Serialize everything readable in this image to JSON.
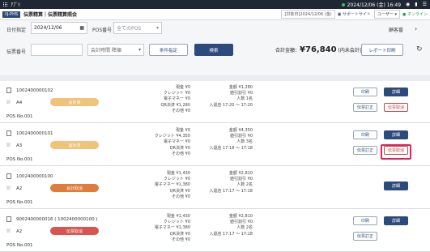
{
  "topbar": {
    "app_name": "ｱﾌﾟﾘ",
    "datetime": "2024/12/06 (金) 16:49"
  },
  "header": {
    "code": "IIJ-PHS",
    "title": "伝票精算｜伝票精算照会",
    "license": "[対象日]2024/12/06 (金)",
    "support": "サポートサイト",
    "user": "ユーザー",
    "status": "オンライン"
  },
  "filters": {
    "date_label": "日付指定",
    "date_value": "2024/12/06",
    "pos_label": "POS番号",
    "pos_value": "全てのPOS",
    "right_label": "顧客番",
    "receipt_label": "伝票番号",
    "sort_value": "会計時間 降順",
    "cond_button": "条件指定",
    "search_button": "検索",
    "total_label": "合計金額：",
    "total_value": "76,840",
    "total_note": "(内未会計金額：0)",
    "report_button": "レポート印刷"
  },
  "rows": [
    {
      "id": "1002400000102",
      "seat": "A4",
      "pos": "POS No.001",
      "badge": "会計済",
      "badge_color": "#f0c27a",
      "c1": [
        [
          "現金",
          "¥0"
        ],
        [
          "クレジット",
          "¥0"
        ],
        [
          "電子マネー",
          "¥0"
        ],
        [
          "QR決済",
          "¥1,280"
        ],
        [
          "その他",
          "¥0"
        ]
      ],
      "c2": [
        [
          "金額",
          "¥1,280"
        ],
        [
          "値引割引",
          "¥0"
        ],
        [
          "人数",
          "1名"
        ],
        [
          "入退店",
          "17:20 ～ 17:20"
        ]
      ],
      "buttons": [
        {
          "label": "印刷",
          "style": "o"
        },
        {
          "label": "詳細",
          "style": "n"
        },
        {
          "label": "伝票訂正",
          "style": "o"
        },
        {
          "label": "伝票取消",
          "style": "r"
        }
      ]
    },
    {
      "id": "1002400000101",
      "seat": "A3",
      "pos": "POS No.001",
      "badge": "会計済",
      "badge_color": "#f0c27a",
      "c1": [
        [
          "現金",
          "¥0"
        ],
        [
          "クレジット",
          "¥4,350"
        ],
        [
          "電子マネー",
          "¥0"
        ],
        [
          "QR決済",
          "¥0"
        ],
        [
          "その他",
          "¥0"
        ]
      ],
      "c2": [
        [
          "金額",
          "¥4,350"
        ],
        [
          "値引割引",
          "¥0"
        ],
        [
          "人数",
          "3名"
        ],
        [
          "入退店",
          "17:18 ～ 17:18"
        ]
      ],
      "buttons": [
        {
          "label": "印刷",
          "style": "o"
        },
        {
          "label": "詳細",
          "style": "n"
        },
        {
          "label": "伝票訂正",
          "style": "o"
        },
        {
          "label": "伝票取消",
          "style": "r"
        }
      ]
    },
    {
      "id": "1002400000100",
      "seat": "A2",
      "pos": "POS No.001",
      "badge": "会計取消",
      "badge_color": "#e07b3a",
      "c1": [
        [
          "現金",
          "¥1,430"
        ],
        [
          "クレジット",
          "¥0"
        ],
        [
          "電子マネー",
          "¥1,380"
        ],
        [
          "QR決済",
          "¥0"
        ],
        [
          "その他",
          "¥0"
        ]
      ],
      "c2": [
        [
          "金額",
          "¥2,810"
        ],
        [
          "値引割引",
          "¥0"
        ],
        [
          "人数",
          "2名"
        ],
        [
          "入退店",
          "17:17 ～ 17:18"
        ]
      ],
      "buttons": [
        {
          "label": "詳細",
          "style": "n"
        }
      ]
    },
    {
      "id": "9002400000016 ( 1002400000100 )",
      "seat": "A2",
      "pos": "POS No.001",
      "badge": "伝票取消",
      "badge_color": "#d9534f",
      "c1": [
        [
          "現金",
          "¥1,430"
        ],
        [
          "クレジット",
          "¥0"
        ],
        [
          "電子マネー",
          "¥1,380"
        ],
        [
          "QR決済",
          "¥0"
        ],
        [
          "その他",
          "¥0"
        ]
      ],
      "c2": [
        [
          "金額",
          "¥2,810"
        ],
        [
          "値引割引",
          "¥0"
        ],
        [
          "人数",
          "2名"
        ],
        [
          "入退店",
          "17:17 ～ 17:18"
        ]
      ],
      "buttons": [
        {
          "label": "印刷",
          "style": "o"
        },
        {
          "label": "詳細",
          "style": "n"
        },
        {
          "label": "伝票訂正",
          "style": "o"
        }
      ]
    }
  ]
}
